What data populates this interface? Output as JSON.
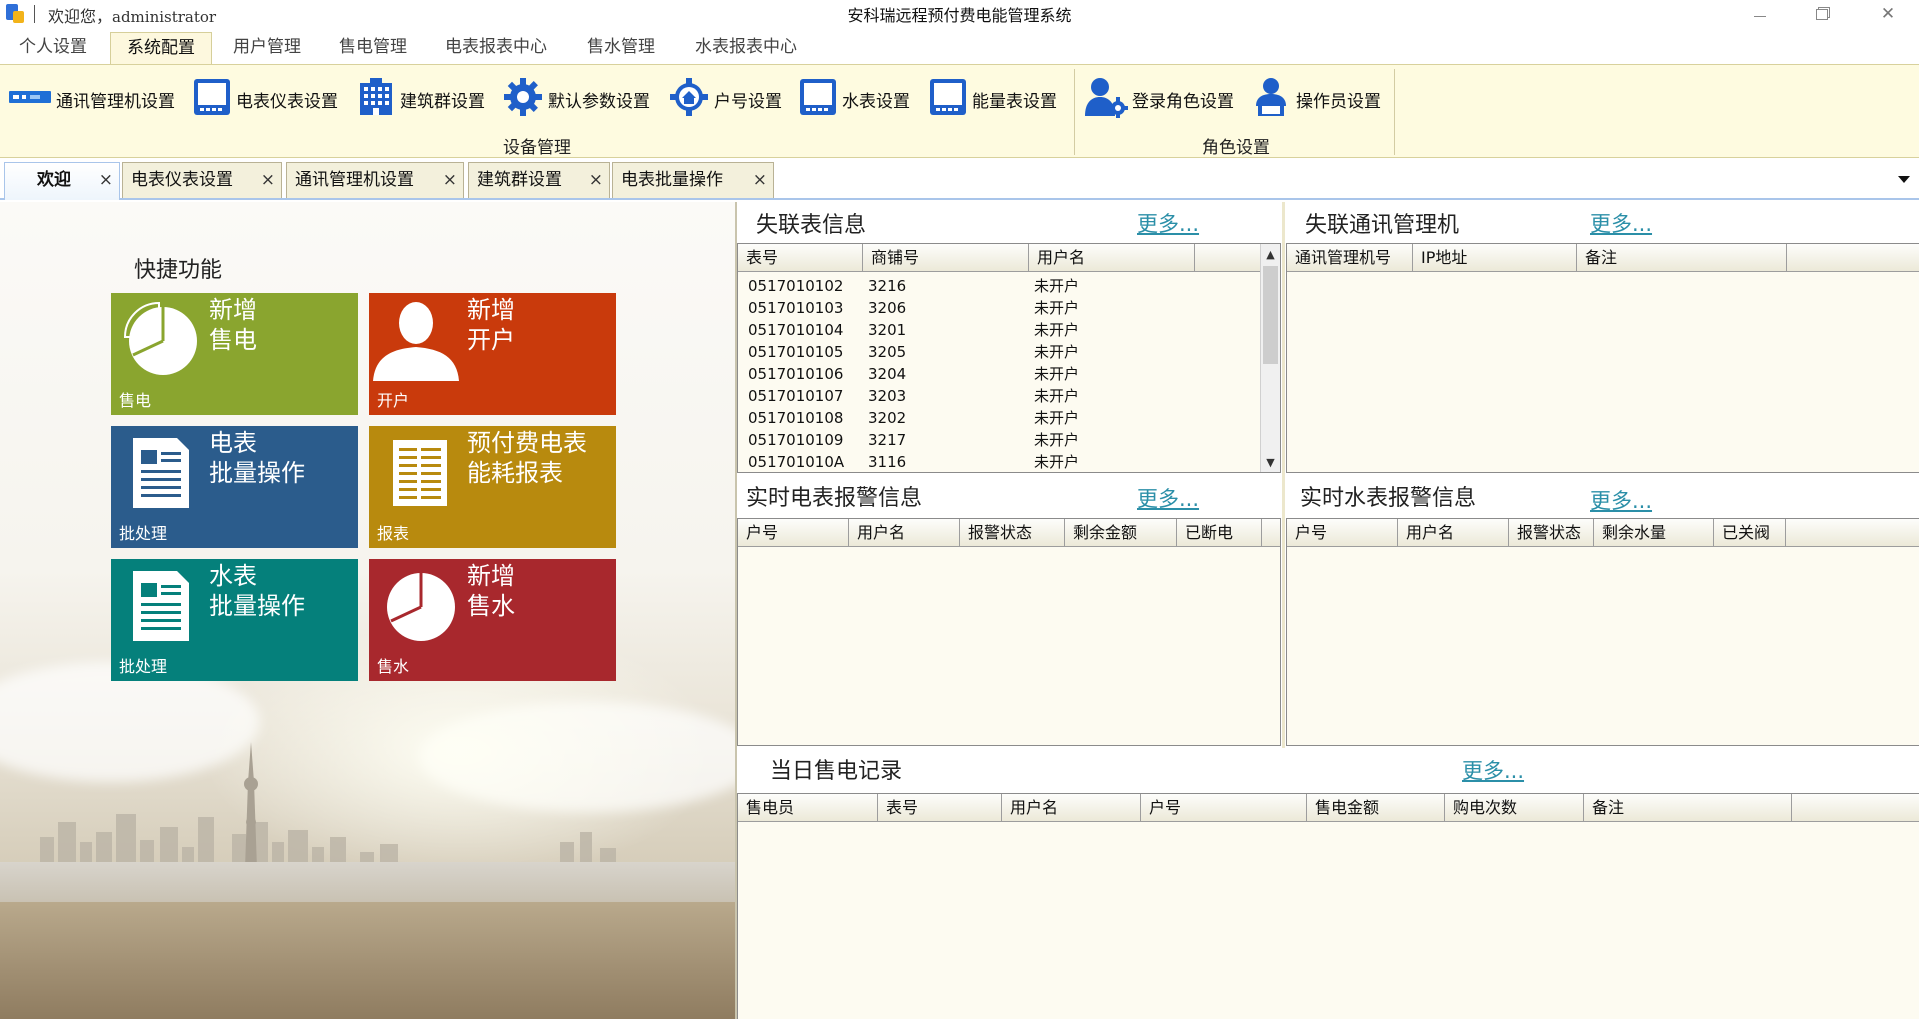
{
  "window": {
    "title": "安科瑞远程预付费电能管理系统",
    "welcome_label": "欢迎您，",
    "username": "administrator"
  },
  "menu_tabs": [
    {
      "label": "个人设置"
    },
    {
      "label": "系统配置",
      "active": true
    },
    {
      "label": "用户管理"
    },
    {
      "label": "售电管理"
    },
    {
      "label": "电表报表中心"
    },
    {
      "label": "售水管理"
    },
    {
      "label": "水表报表中心"
    }
  ],
  "ribbon": {
    "device_group_label": "设备管理",
    "role_group_label": "角色设置",
    "buttons": [
      {
        "label": "通讯管理机设置",
        "icon": "comm-manager-icon"
      },
      {
        "label": "电表仪表设置",
        "icon": "meter-icon"
      },
      {
        "label": "建筑群设置",
        "icon": "building-icon"
      },
      {
        "label": "默认参数设置",
        "icon": "gear-icon"
      },
      {
        "label": "户号设置",
        "icon": "house-gear-icon"
      },
      {
        "label": "水表设置",
        "icon": "water-meter-icon"
      },
      {
        "label": "能量表设置",
        "icon": "energy-meter-icon"
      },
      {
        "label": "登录角色设置",
        "icon": "user-gear-icon"
      },
      {
        "label": "操作员设置",
        "icon": "operator-icon"
      }
    ]
  },
  "doc_tabs": [
    {
      "label": "欢迎",
      "active": true
    },
    {
      "label": "电表仪表设置"
    },
    {
      "label": "通讯管理机设置"
    },
    {
      "label": "建筑群设置"
    },
    {
      "label": "电表批量操作"
    }
  ],
  "close_glyph": "×",
  "quick": {
    "title": "快捷功能",
    "tiles": [
      {
        "title": "新增\n售电",
        "sub": "售电",
        "color": "#8aa52f",
        "icon": "pie-chart-icon"
      },
      {
        "title": "新增\n开户",
        "sub": "开户",
        "color": "#c93a0c",
        "icon": "person-icon"
      },
      {
        "title": "电表\n批量操作",
        "sub": "批处理",
        "color": "#2b5c8c",
        "icon": "document-icon"
      },
      {
        "title": "预付费电表\n能耗报表",
        "sub": "报表",
        "color": "#b88a0e",
        "icon": "report-icon"
      },
      {
        "title": "水表\n批量操作",
        "sub": "批处理",
        "color": "#05807b",
        "icon": "document-icon"
      },
      {
        "title": "新增\n售水",
        "sub": "售水",
        "color": "#a8282d",
        "icon": "pie-chart-icon"
      }
    ]
  },
  "offline_meters": {
    "title": "失联表信息",
    "more": "更多...",
    "columns": [
      "表号",
      "商铺号",
      "用户名"
    ],
    "rows": [
      [
        "0517010102",
        "3216",
        "未开户"
      ],
      [
        "0517010103",
        "3206",
        "未开户"
      ],
      [
        "0517010104",
        "3201",
        "未开户"
      ],
      [
        "0517010105",
        "3205",
        "未开户"
      ],
      [
        "0517010106",
        "3204",
        "未开户"
      ],
      [
        "0517010107",
        "3203",
        "未开户"
      ],
      [
        "0517010108",
        "3202",
        "未开户"
      ],
      [
        "0517010109",
        "3217",
        "未开户"
      ],
      [
        "051701010A",
        "3116",
        "未开户"
      ]
    ]
  },
  "offline_comm": {
    "title": "失联通讯管理机",
    "more": "更多...",
    "columns": [
      "通讯管理机号",
      "IP地址",
      "备注"
    ]
  },
  "elec_alarm": {
    "title": "实时电表报警信息",
    "more": "更多...",
    "columns": [
      "户号",
      "用户名",
      "报警状态",
      "剩余金额",
      "已断电"
    ]
  },
  "water_alarm": {
    "title": "实时水表报警信息",
    "more": "更多...",
    "columns": [
      "户号",
      "用户名",
      "报警状态",
      "剩余水量",
      "已关阀"
    ]
  },
  "sales": {
    "title": "当日售电记录",
    "more": "更多...",
    "columns": [
      "售电员",
      "表号",
      "用户名",
      "户号",
      "售电金额",
      "购电次数",
      "备注"
    ]
  }
}
